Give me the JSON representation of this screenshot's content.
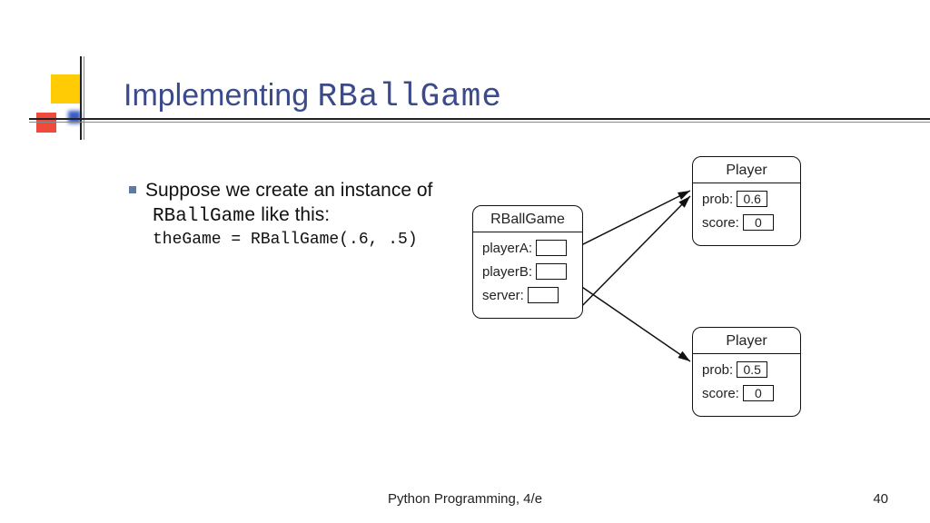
{
  "title": {
    "prefix": "Implementing ",
    "code": "RBallGame"
  },
  "bullet": {
    "part1": "Suppose we create an instance of ",
    "code_inline": "RBallGame",
    "part2": " like this:",
    "code_line": "theGame = RBallGame(.6, .5)"
  },
  "diagram": {
    "rball": {
      "title": "RBallGame",
      "rows": [
        {
          "label": "playerA:"
        },
        {
          "label": "playerB:"
        },
        {
          "label": "server:"
        }
      ]
    },
    "player1": {
      "title": "Player",
      "prob_label": "prob:",
      "prob_value": "0.6",
      "score_label": "score:",
      "score_value": "0"
    },
    "player2": {
      "title": "Player",
      "prob_label": "prob:",
      "prob_value": "0.5",
      "score_label": "score:",
      "score_value": "0"
    }
  },
  "footer": "Python Programming, 4/e",
  "page": "40"
}
